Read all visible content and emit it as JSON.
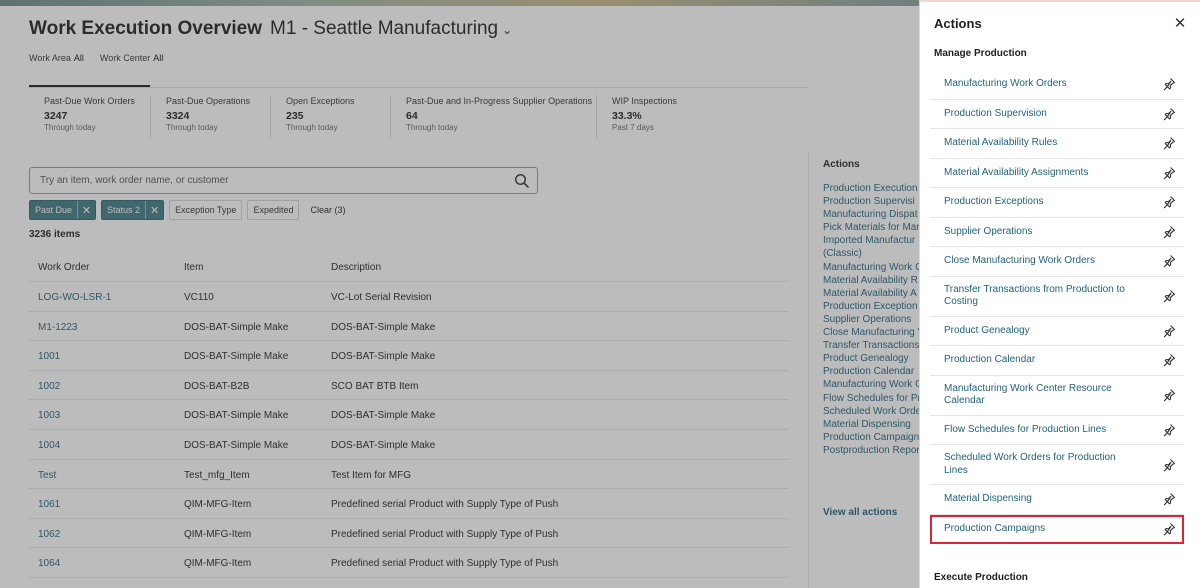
{
  "page": {
    "title": "Work Execution Overview",
    "site": "M1 - Seattle Manufacturing",
    "work_area_label": "Work Area",
    "work_area_value": "All",
    "work_center_label": "Work Center",
    "work_center_value": "All"
  },
  "metrics": [
    {
      "label": "Past-Due Work Orders",
      "value": "3247",
      "sub": "Through today"
    },
    {
      "label": "Past-Due Operations",
      "value": "3324",
      "sub": "Through today"
    },
    {
      "label": "Open Exceptions",
      "value": "235",
      "sub": "Through today"
    },
    {
      "label": "Past-Due and In-Progress Supplier Operations",
      "value": "64",
      "sub": "Through today"
    },
    {
      "label": "WIP Inspections",
      "value": "33.3%",
      "sub": "Past 7 days"
    }
  ],
  "search": {
    "placeholder": "Try an item, work order name, or customer"
  },
  "chips": {
    "past_due": "Past Due",
    "status": "Status 2",
    "exception_type": "Exception Type",
    "expedited": "Expedited",
    "clear": "Clear (3)"
  },
  "items_count": "3236 items",
  "table": {
    "headers": [
      "Work Order",
      "Item",
      "Description"
    ],
    "rows": [
      [
        "LOG-WO-LSR-1",
        "VC110",
        "VC-Lot Serial Revision"
      ],
      [
        "M1-1223",
        "DOS-BAT-Simple Make",
        "DOS-BAT-Simple Make"
      ],
      [
        "1001",
        "DOS-BAT-Simple Make",
        "DOS-BAT-Simple Make"
      ],
      [
        "1002",
        "DOS-BAT-B2B",
        "SCO BAT BTB Item"
      ],
      [
        "1003",
        "DOS-BAT-Simple Make",
        "DOS-BAT-Simple Make"
      ],
      [
        "1004",
        "DOS-BAT-Simple Make",
        "DOS-BAT-Simple Make"
      ],
      [
        "Test",
        "Test_mfg_Item",
        "Test Item for MFG"
      ],
      [
        "1061",
        "QIM-MFG-Item",
        "Predefined serial Product with Supply Type of Push"
      ],
      [
        "1062",
        "QIM-MFG-Item",
        "Predefined serial Product with Supply Type of Push"
      ],
      [
        "1064",
        "QIM-MFG-Item",
        "Predefined serial Product with Supply Type of Push"
      ]
    ]
  },
  "side_actions": {
    "title": "Actions",
    "items": [
      "Production Execution",
      "Production Supervisi",
      "Manufacturing Dispat",
      "Pick Materials for Mar",
      "Imported Manufactur",
      "(Classic)",
      "Manufacturing Work C",
      "Material Availability R",
      "Material Availability A",
      "Production Exception",
      "Supplier Operations",
      "Close Manufacturing '",
      "Transfer Transactions",
      "Product Genealogy",
      "Production Calendar",
      "Manufacturing Work C",
      "Flow Schedules for Pr",
      "Scheduled Work Orde",
      "Material Dispensing",
      "Production Campaign",
      "Postproduction Repor"
    ],
    "view_all": "View all actions"
  },
  "drawer": {
    "title": "Actions",
    "section": "Manage Production",
    "items": [
      "Manufacturing Work Orders",
      "Production Supervision",
      "Material Availability Rules",
      "Material Availability Assignments",
      "Production Exceptions",
      "Supplier Operations",
      "Close Manufacturing Work Orders",
      "Transfer Transactions from Production to Costing",
      "Product Genealogy",
      "Production Calendar",
      "Manufacturing Work Center Resource Calendar",
      "Flow Schedules for Production Lines",
      "Scheduled Work Orders for Production Lines",
      "Material Dispensing",
      "Production Campaigns"
    ],
    "section2": "Execute Production"
  },
  "colors": {
    "link": "#21627a",
    "chip_active": "#3d7a85",
    "highlight": "#e0232e"
  }
}
